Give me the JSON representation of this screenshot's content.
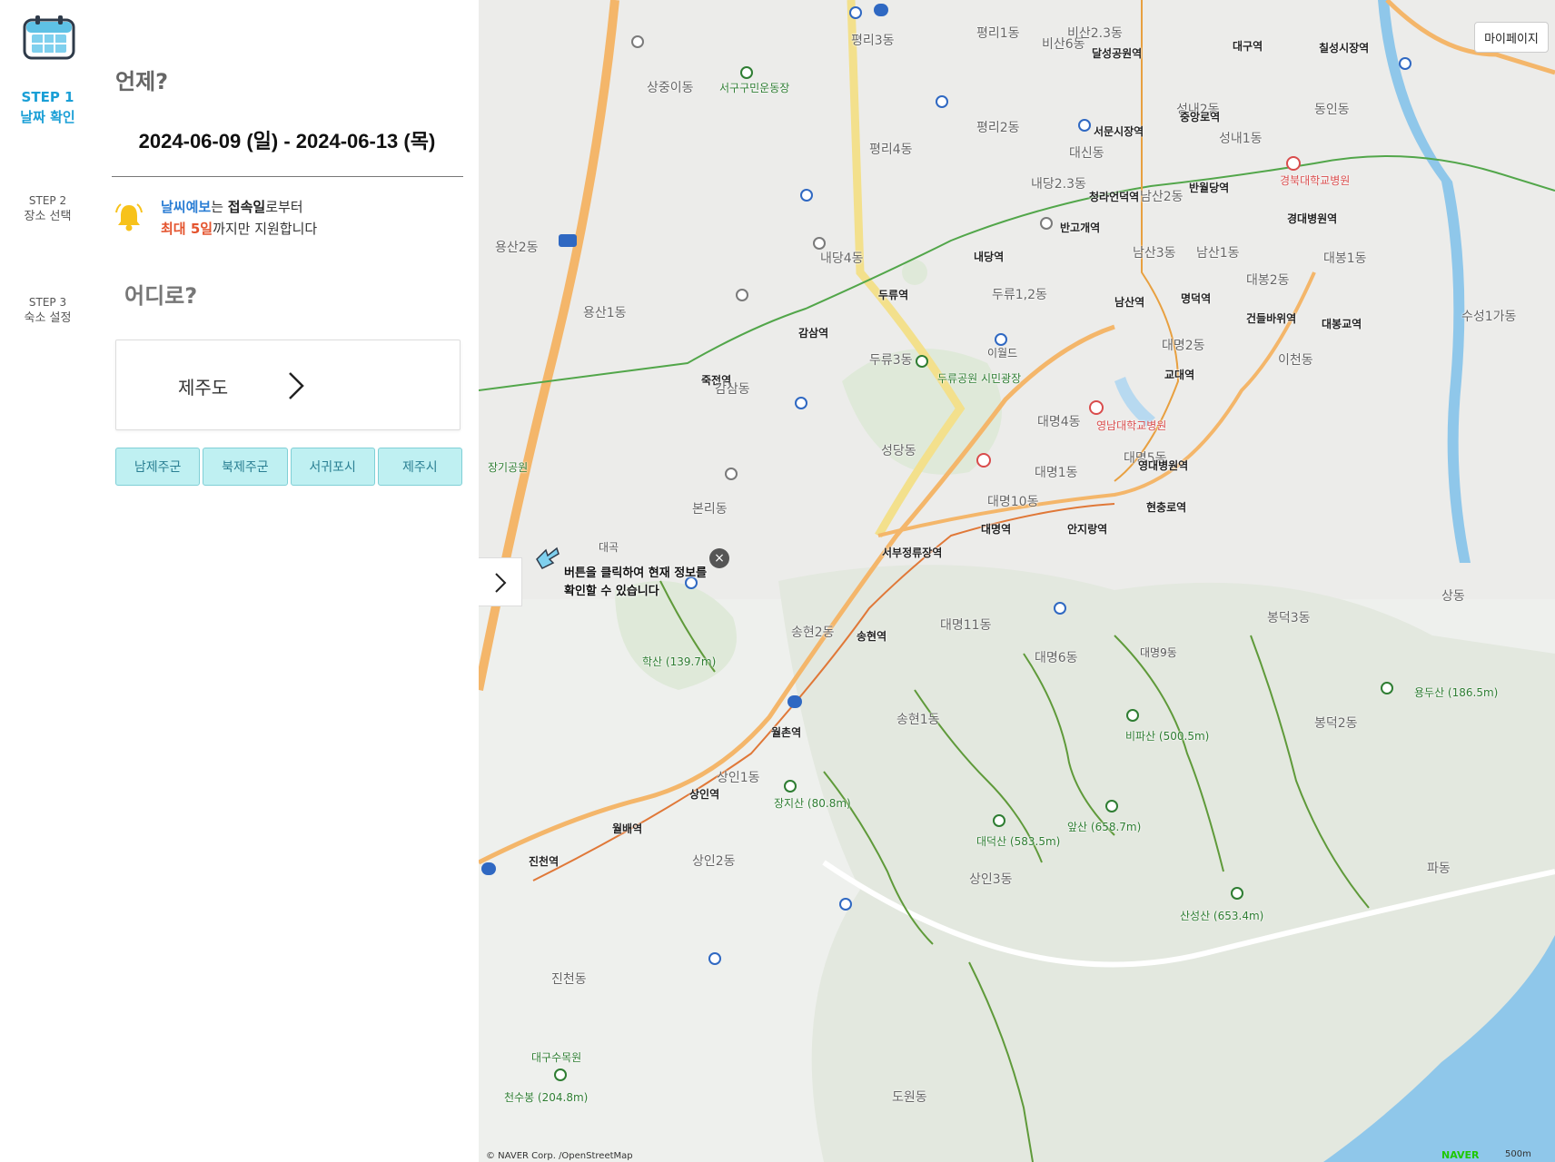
{
  "steps": [
    {
      "num": "STEP 1",
      "label": "날짜 확인",
      "active": true
    },
    {
      "num": "STEP 2",
      "label": "장소 선택",
      "active": false
    },
    {
      "num": "STEP 3",
      "label": "숙소 설정",
      "active": false
    }
  ],
  "when": {
    "heading": "언제?",
    "date_range": "2024-06-09 (일) - 2024-06-13 (목)"
  },
  "notice": {
    "part1_blue": "날씨예보",
    "part2": "는",
    "part3_bold": "접속일",
    "part4": "로부터",
    "part5_red": "최대 5일",
    "part6": "까지만 지원합니다"
  },
  "where": {
    "heading": "어디로?",
    "selected_region": "제주도",
    "subregions": [
      "남제주군",
      "북제주군",
      "서귀포시",
      "제주시"
    ]
  },
  "map": {
    "mypage_label": "마이페이지",
    "tooltip": "버튼을 클릭하여 현재 정보를 확인할 수 있습니다",
    "tooltip_line1": "버튼을 클릭하여 현재 정보를",
    "tooltip_line2": "확인할 수 있습니다",
    "attribution": "© NAVER Corp. /OpenStreetMap",
    "naver_logo": "NAVER",
    "scale": "500m",
    "labels": {
      "l1": "평리3동",
      "l2": "평리1동",
      "l3": "비산6동",
      "l4": "비산2.3동",
      "l5": "달성공원역",
      "l6": "대구역",
      "l7": "칠성시장역",
      "l8": "상중이동",
      "l9": "서구구민운동장",
      "l10": "평리4동",
      "l11": "평리2동",
      "l12": "대신동",
      "l13": "서문시장역",
      "l14": "성내2동",
      "l15": "중앙로역",
      "l16": "성내1동",
      "l17": "동인동",
      "l18": "반월당역",
      "l19": "경북대학교병원",
      "l20": "청라언덕역",
      "l21": "내당2.3동",
      "l22": "남산2동",
      "l23": "경대병원역",
      "l24": "반고개역",
      "l25": "내당4동",
      "l26": "내당역",
      "l27": "남산3동",
      "l28": "남산1동",
      "l29": "대봉1동",
      "l30": "두류역",
      "l31": "두류1,2동",
      "l32": "남산역",
      "l33": "명덕역",
      "l34": "대봉2동",
      "l35": "건들바위역",
      "l36": "대봉교역",
      "l37": "감삼역",
      "l38": "두류3동",
      "l39": "이월드",
      "l40": "대명2동",
      "l41": "교대역",
      "l42": "이천동",
      "l43": "죽전역",
      "l44": "감삼동",
      "l45": "두류공원 시민광장",
      "l46": "대명4동",
      "l47": "영남대학교병원",
      "l48": "대명5동",
      "l49": "영대병원역",
      "l50": "성당동",
      "l51": "대명1동",
      "l52": "대명10동",
      "l53": "현충로역",
      "l54": "본리동",
      "l55": "서부정류장역",
      "l56": "대명역",
      "l57": "안지랑역",
      "l58": "송현2동",
      "l59": "송현역",
      "l60": "대명11동",
      "l61": "봉덕3동",
      "l62": "대명6동",
      "l63": "대명9동",
      "l64": "상동",
      "l65": "학산 (139.7m)",
      "l66": "송현1동",
      "l67": "월촌역",
      "l68": "봉덕2동",
      "l69": "비파산 (500.5m)",
      "l70": "용두산 (186.5m)",
      "l71": "상인1동",
      "l72": "상인역",
      "l73": "장지산 (80.8m)",
      "l74": "대덕산 (583.5m)",
      "l75": "앞산 (658.7m)",
      "l76": "월배역",
      "l77": "진천역",
      "l78": "상인2동",
      "l79": "상인3동",
      "l80": "산성산 (653.4m)",
      "l81": "파동",
      "l82": "진천동",
      "l83": "도원동",
      "l84": "천수봉 (204.8m)",
      "l85": "대구수목원",
      "l86": "용산1동",
      "l87": "용산2동",
      "l88": "장기공원",
      "l89": "대곡",
      "l90": "수성1가동"
    }
  },
  "colors": {
    "accent": "#1a9fd6",
    "subregion_bg": "#bff0f2",
    "subregion_border": "#7fcfd6",
    "red_text": "#e4542e",
    "blue_text": "#2b7ed4"
  }
}
